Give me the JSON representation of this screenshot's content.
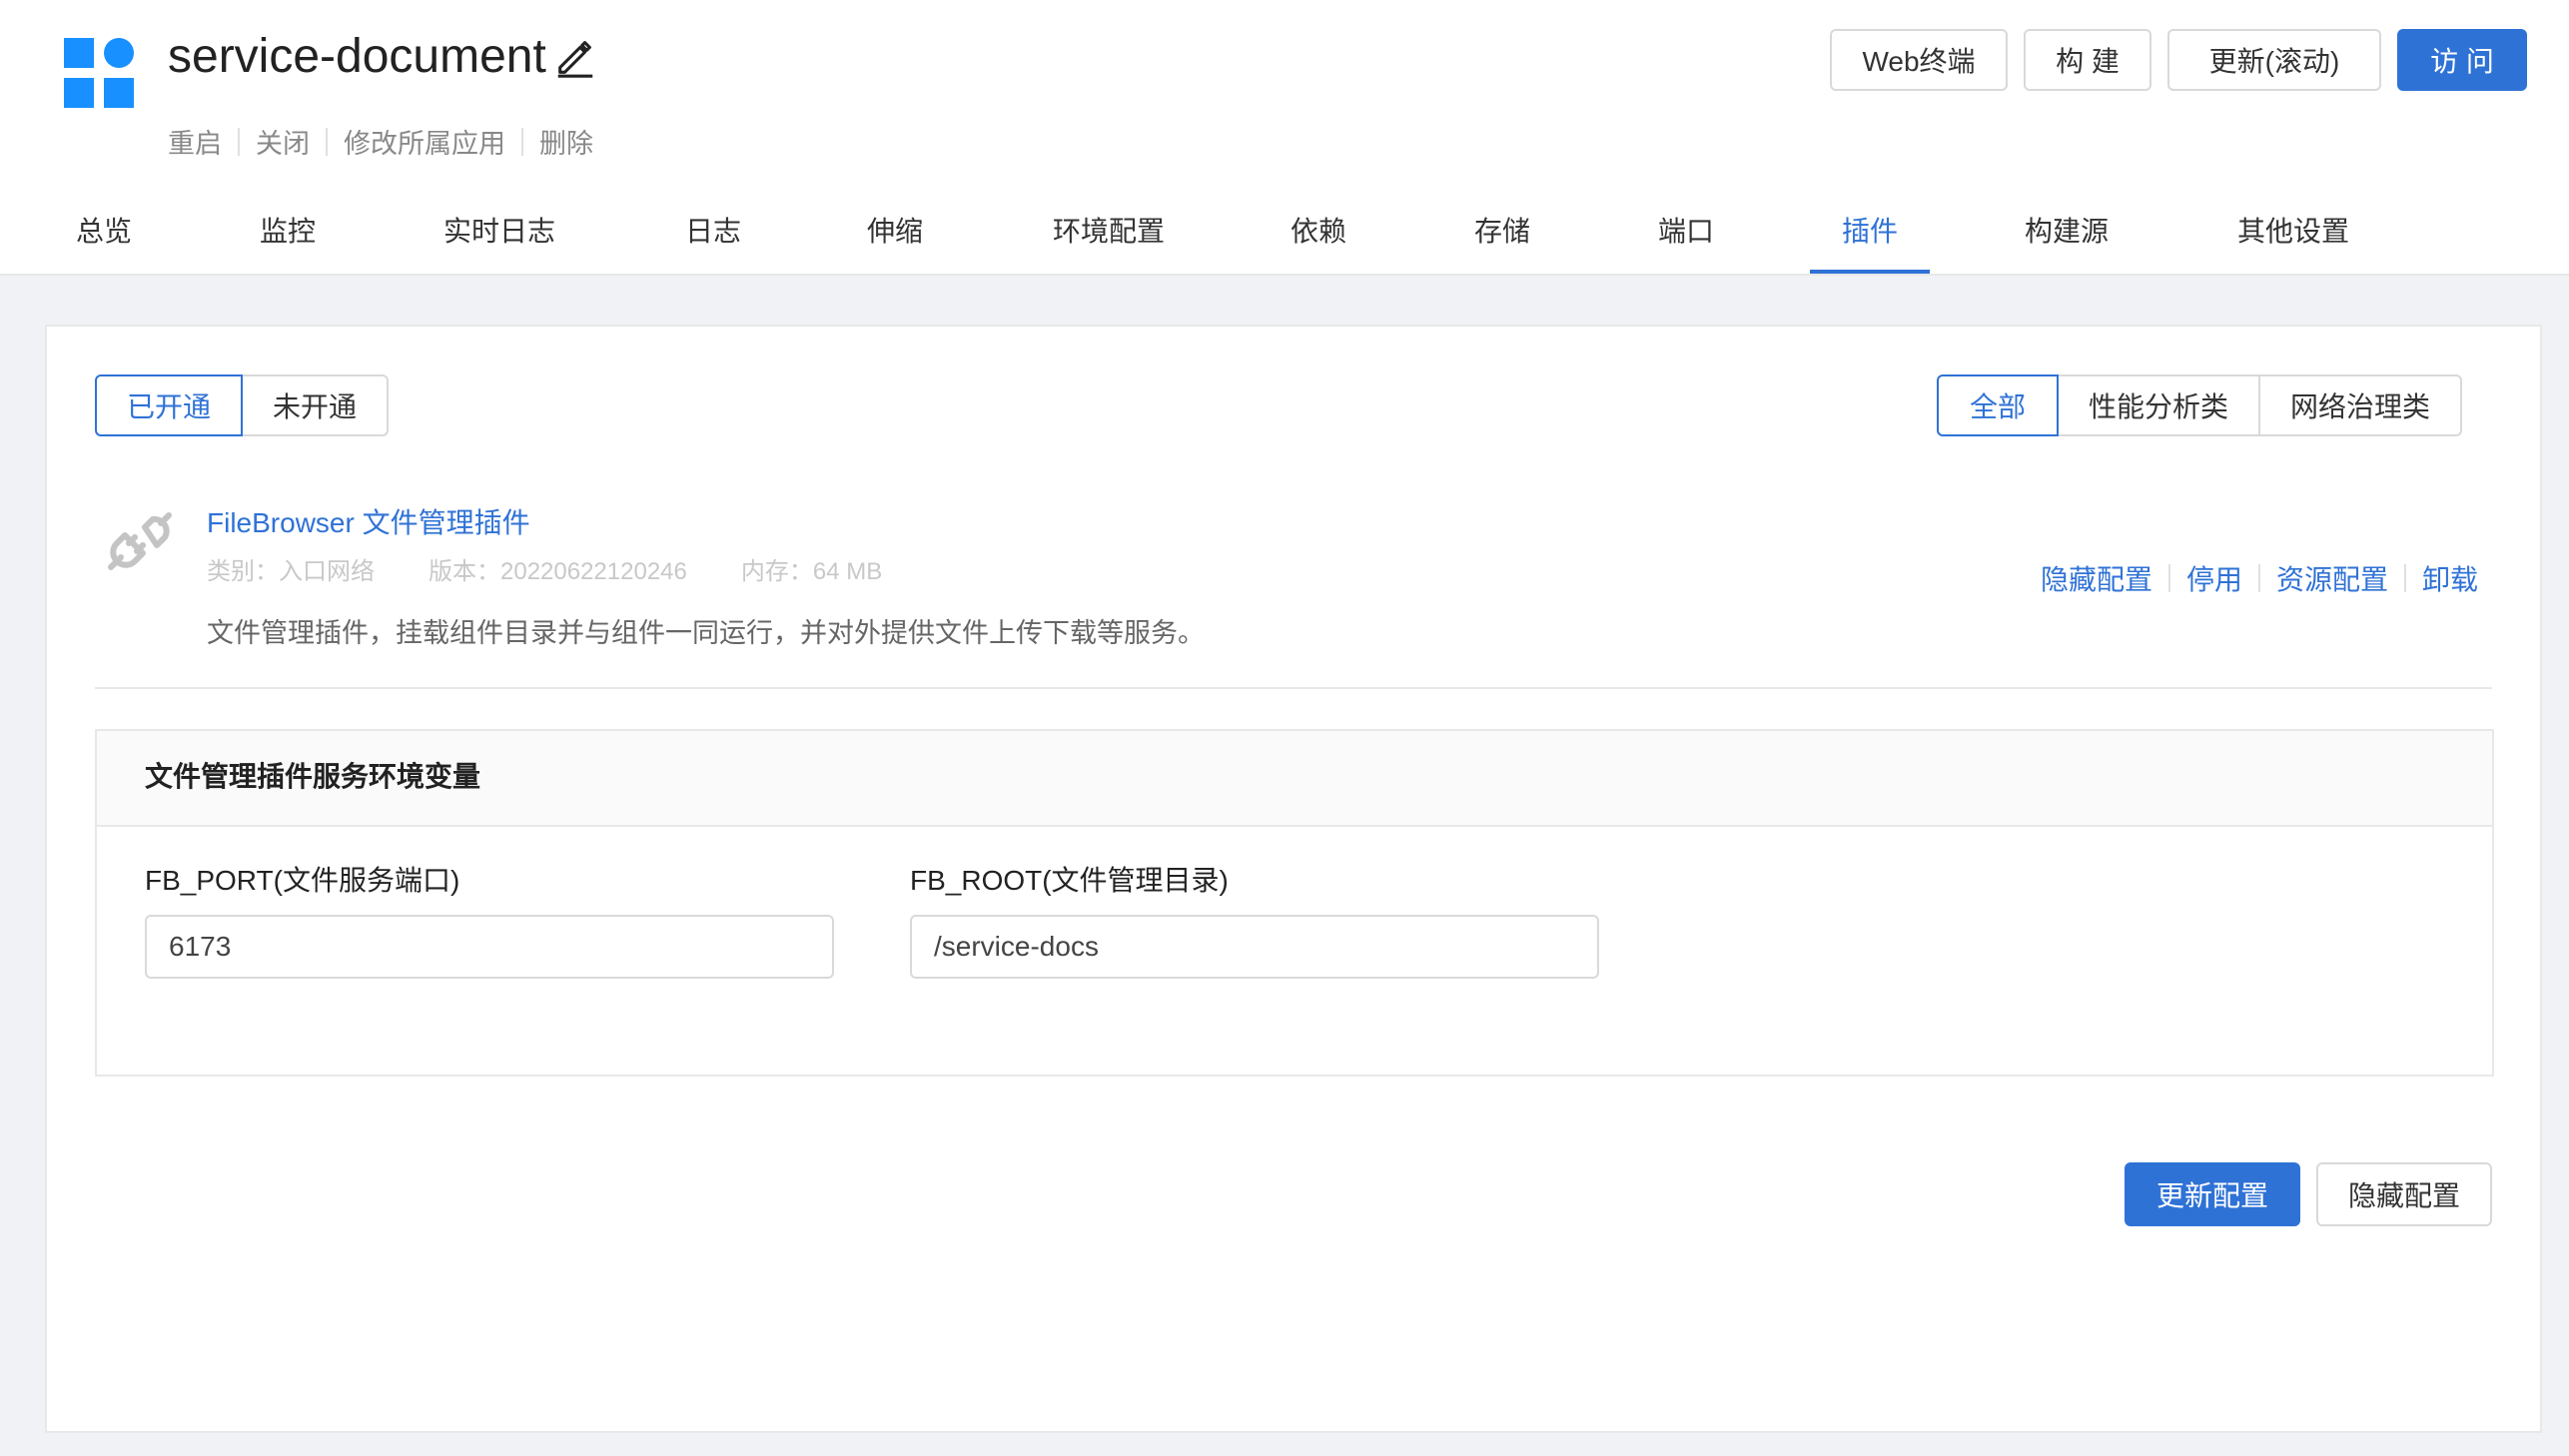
{
  "header": {
    "title": "service-document",
    "actions": [
      "重启",
      "关闭",
      "修改所属应用",
      "删除"
    ],
    "buttons": {
      "terminal": "Web终端",
      "build": "构 建",
      "update": "更新(滚动)",
      "visit": "访 问"
    }
  },
  "tabs": [
    {
      "label": "总览"
    },
    {
      "label": "监控"
    },
    {
      "label": "实时日志"
    },
    {
      "label": "日志"
    },
    {
      "label": "伸缩"
    },
    {
      "label": "环境配置"
    },
    {
      "label": "依赖"
    },
    {
      "label": "存储"
    },
    {
      "label": "端口"
    },
    {
      "label": "插件",
      "active": true
    },
    {
      "label": "构建源"
    },
    {
      "label": "其他设置"
    }
  ],
  "filters": {
    "status": [
      "已开通",
      "未开通"
    ],
    "status_selected": "已开通",
    "category": [
      "全部",
      "性能分析类",
      "网络治理类"
    ],
    "category_selected": "全部"
  },
  "plugin": {
    "icon": "plug-icon",
    "name": "FileBrowser 文件管理插件",
    "category_label": "类别：",
    "category": "入口网络",
    "version_label": "版本：",
    "version": "20220622120246",
    "memory_label": "内存：",
    "memory": "64 MB",
    "description": "文件管理插件，挂载组件目录并与组件一同运行，并对外提供文件上传下载等服务。",
    "actions": [
      "隐藏配置",
      "停用",
      "资源配置",
      "卸载"
    ]
  },
  "env": {
    "title": "文件管理插件服务环境变量",
    "fields": [
      {
        "label": "FB_PORT(文件服务端口)",
        "value": "6173"
      },
      {
        "label": "FB_ROOT(文件管理目录)",
        "value": "/service-docs"
      }
    ]
  },
  "footer": {
    "update_label": "更新配置",
    "hide_label": "隐藏配置"
  },
  "colors": {
    "accent": "#2f72d6",
    "logo": "#1890ff",
    "background": "#f0f2f5"
  }
}
